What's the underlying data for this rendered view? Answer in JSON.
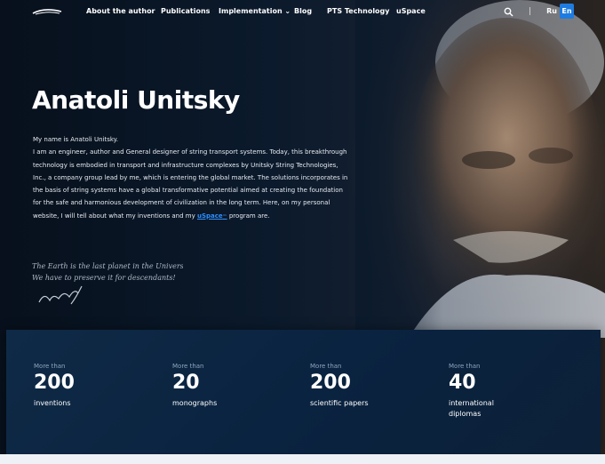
{
  "nav": {
    "items": [
      {
        "label": "About the author"
      },
      {
        "label": "Publications"
      },
      {
        "label": "Implementation ⌄"
      },
      {
        "label": "Blog"
      },
      {
        "label": "PTS Technology"
      },
      {
        "label": "uSpace"
      }
    ],
    "languages": [
      "Ru",
      "En"
    ],
    "active_language": "En"
  },
  "hero": {
    "title": "Anatoli Unitsky",
    "intro_lines": [
      "My name is Anatoli Unitsky.",
      "I am an engineer, author and General designer of string transport systems. Today, this breakthrough technology is embodied in transport and infrastructure complexes by Unitsky String Technologies, Inc., a company group lead by me, which is entering the global market. The solutions incorporates in the basis of string systems have a global transformative potential aimed at creating the foundation for the safe and harmonious development of civilization in the long term. Here, on my personal website, I will tell about what my inventions and my"
    ],
    "link_text": "uSpace",
    "link_suffix": "™",
    "after_link": " program are.",
    "quote_lines": [
      "The Earth is the last planet in the Universe.",
      "We have to preserve it for descendants!"
    ]
  },
  "stats": [
    {
      "prefix": "More than",
      "value": "200",
      "label": "inventions"
    },
    {
      "prefix": "More than",
      "value": "20",
      "label": "monographs"
    },
    {
      "prefix": "More than",
      "value": "200",
      "label": "scientific papers"
    },
    {
      "prefix": "More than",
      "value": "40",
      "label": "international diplomas"
    }
  ],
  "colors": {
    "accent": "#1e7be0",
    "link": "#2e90ff",
    "stats_bg": "#0f2a46"
  }
}
